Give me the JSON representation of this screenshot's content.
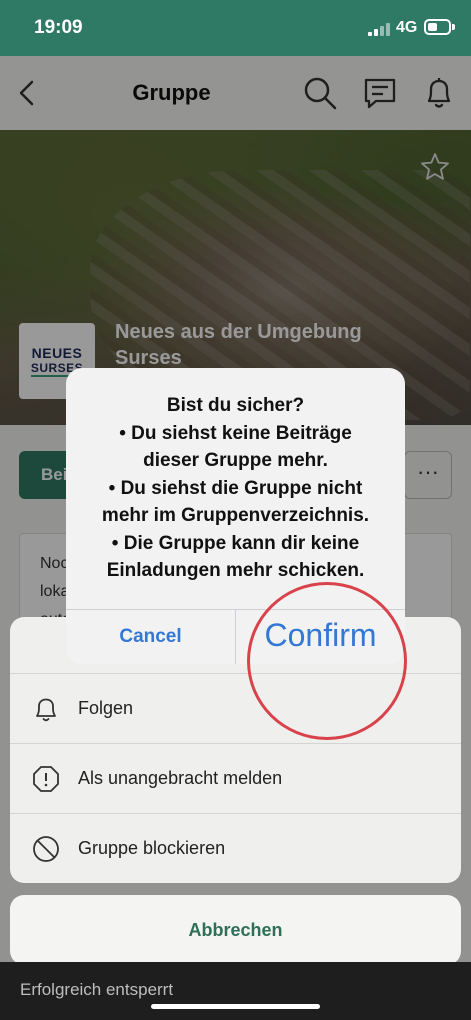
{
  "status_bar": {
    "time": "19:09",
    "network": "4G"
  },
  "nav": {
    "title": "Gruppe"
  },
  "group": {
    "name": "Neues aus der Umgebung Surses",
    "logo_line1": "NEUES",
    "logo_line2": "SURSES"
  },
  "content": {
    "join_label": "Bei",
    "more_label": "···",
    "description_lines": [
      "Noc",
      "loka",
      "auto"
    ]
  },
  "alert": {
    "lines": [
      "Bist du sicher?",
      "• Du siehst keine Beiträge",
      "dieser Gruppe mehr.",
      "• Du siehst die Gruppe nicht",
      "mehr im Gruppenverzeichnis.",
      "• Die Gruppe kann dir keine",
      "Einladungen mehr schicken."
    ],
    "cancel_label": "Cancel",
    "confirm_label": "Confirm"
  },
  "sheet": {
    "items": [
      {
        "label": "Folgen",
        "icon": "bell-icon"
      },
      {
        "label": "Als unangebracht melden",
        "icon": "alert-octagon-icon"
      },
      {
        "label": "Gruppe blockieren",
        "icon": "block-icon"
      }
    ],
    "cancel_label": "Abbrechen"
  },
  "toast": {
    "text": "Erfolgreich entsperrt"
  },
  "colors": {
    "brand": "#2f7a64",
    "link": "#3478d6",
    "highlight": "#d9424a"
  }
}
